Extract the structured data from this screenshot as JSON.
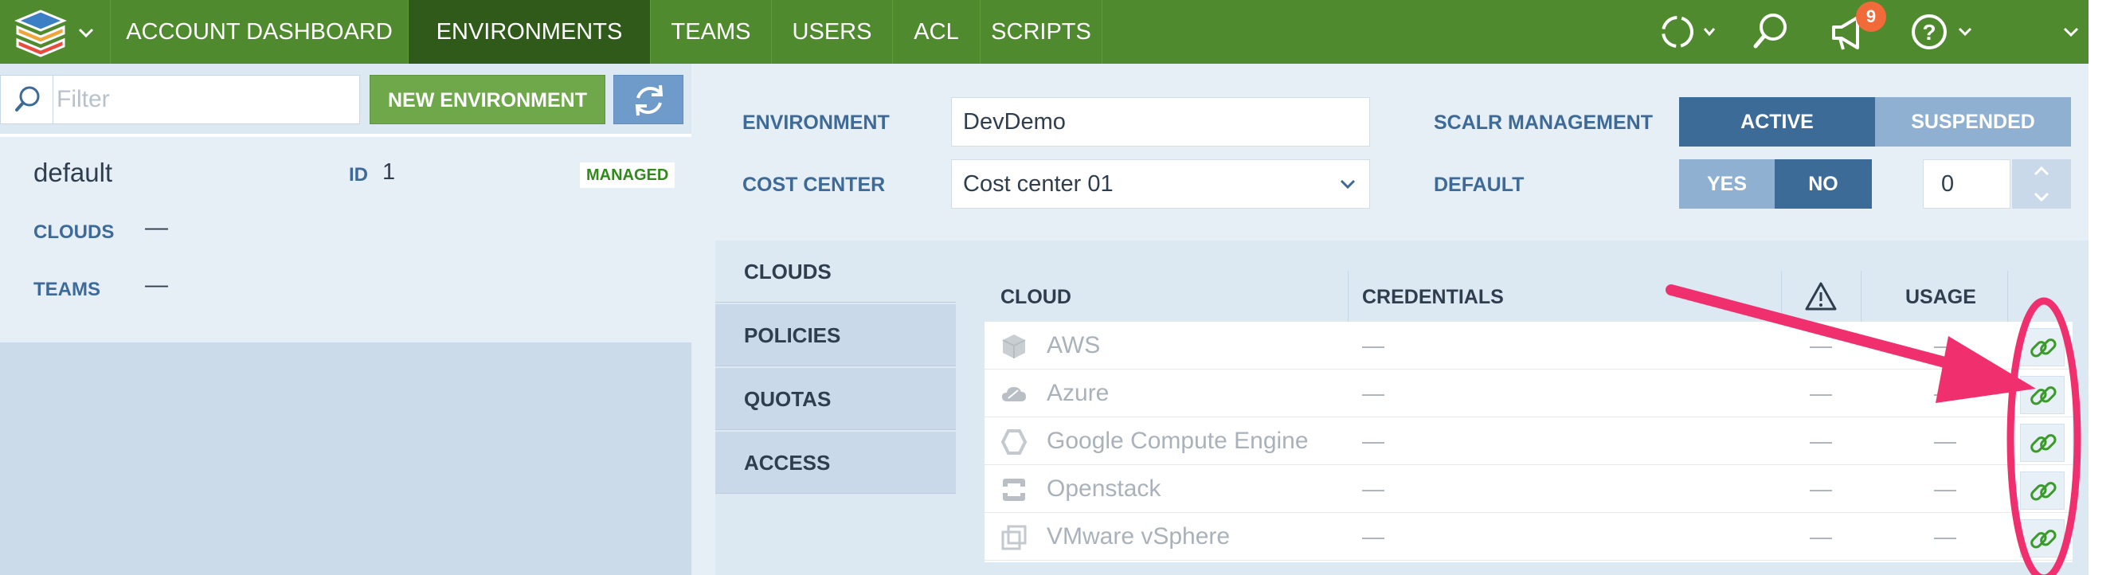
{
  "nav": {
    "items": [
      {
        "label": "ACCOUNT DASHBOARD"
      },
      {
        "label": "ENVIRONMENTS"
      },
      {
        "label": "TEAMS"
      },
      {
        "label": "USERS"
      },
      {
        "label": "ACL"
      },
      {
        "label": "SCRIPTS"
      }
    ],
    "active_index": 1,
    "notifications_count": "9",
    "icons": [
      "scalr-logo-icon",
      "refresh-status-icon",
      "search-icon",
      "megaphone-icon",
      "help-icon"
    ]
  },
  "sidebar": {
    "filter_placeholder": "Filter",
    "new_environment_label": "NEW ENVIRONMENT",
    "env": {
      "name": "default",
      "id_label": "ID",
      "id_value": "1",
      "badge": "MANAGED",
      "clouds_label": "CLOUDS",
      "clouds_value": "—",
      "teams_label": "TEAMS",
      "teams_value": "—"
    }
  },
  "form": {
    "environment_label": "ENVIRONMENT",
    "environment_value": "DevDemo",
    "cost_center_label": "COST CENTER",
    "cost_center_value": "Cost center 01",
    "scalr_management_label": "SCALR MANAGEMENT",
    "management_options": [
      "ACTIVE",
      "SUSPENDED"
    ],
    "management_selected": "ACTIVE",
    "default_label": "DEFAULT",
    "default_options": [
      "YES",
      "NO"
    ],
    "default_selected": "NO",
    "priority_value": "0"
  },
  "tabs": [
    {
      "label": "CLOUDS"
    },
    {
      "label": "POLICIES"
    },
    {
      "label": "QUOTAS"
    },
    {
      "label": "ACCESS"
    }
  ],
  "active_tab": "CLOUDS",
  "cloud_table": {
    "headers": {
      "cloud": "CLOUD",
      "credentials": "CREDENTIALS",
      "usage": "USAGE"
    },
    "rows": [
      {
        "cloud": "AWS",
        "credentials": "—",
        "warning": "—",
        "usage": "—"
      },
      {
        "cloud": "Azure",
        "credentials": "—",
        "warning": "—",
        "usage": "—"
      },
      {
        "cloud": "Google Compute Engine",
        "credentials": "—",
        "warning": "—",
        "usage": "—"
      },
      {
        "cloud": "Openstack",
        "credentials": "—",
        "warning": "—",
        "usage": "—"
      },
      {
        "cloud": "VMware vSphere",
        "credentials": "—",
        "warning": "—",
        "usage": "—"
      }
    ]
  },
  "colors": {
    "nav_bg": "#4f8a2e",
    "nav_active": "#2f5a1a",
    "accent_blue": "#3d6b98",
    "link_green": "#3a9a2a",
    "annotation_pink": "#f0306e"
  }
}
